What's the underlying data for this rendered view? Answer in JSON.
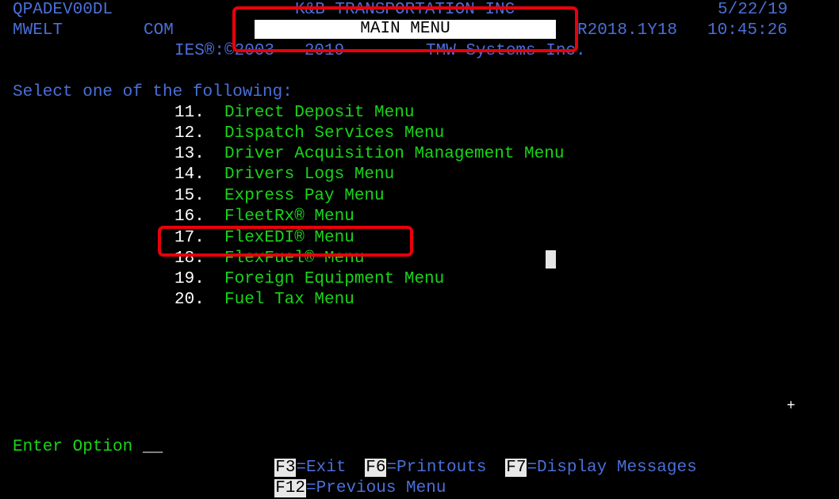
{
  "header": {
    "system_id": "QPADEV00DL",
    "company_name": "K&B TRANSPORTATION INC",
    "date": "5/22/19",
    "user": "MWELT",
    "env": "COM",
    "menu_title": "MAIN MENU",
    "version": "R2018.1Y18",
    "time": "10:45:26",
    "copyright": "IES®:©2003 - 2019",
    "vendor": "TMW Systems Inc."
  },
  "prompt": "Select one of the following:",
  "menu_items": [
    {
      "num": "11.",
      "label": "Direct Deposit Menu"
    },
    {
      "num": "12.",
      "label": "Dispatch Services Menu"
    },
    {
      "num": "13.",
      "label": "Driver Acquisition Management Menu"
    },
    {
      "num": "14.",
      "label": "Drivers Logs Menu"
    },
    {
      "num": "15.",
      "label": "Express Pay Menu"
    },
    {
      "num": "16.",
      "label": "FleetRx® Menu"
    },
    {
      "num": "17.",
      "label": "FlexEDI® Menu"
    },
    {
      "num": "18.",
      "label": "FlexFuel® Menu"
    },
    {
      "num": "19.",
      "label": "Foreign Equipment Menu"
    },
    {
      "num": "20.",
      "label": "Fuel Tax Menu"
    }
  ],
  "more_indicator": "+",
  "footer": {
    "option_label": "Enter Option",
    "option_value": "__",
    "keys": [
      {
        "key": "F3",
        "desc": "=Exit"
      },
      {
        "key": "F6",
        "desc": "=Printouts"
      },
      {
        "key": "F7",
        "desc": "=Display Messages"
      },
      {
        "key": "F12",
        "desc": "=Previous Menu"
      }
    ]
  },
  "colors": {
    "background": "#000000",
    "info_text": "#4a6fd8",
    "menu_text": "#19d419",
    "highlight": "#e8000b"
  }
}
